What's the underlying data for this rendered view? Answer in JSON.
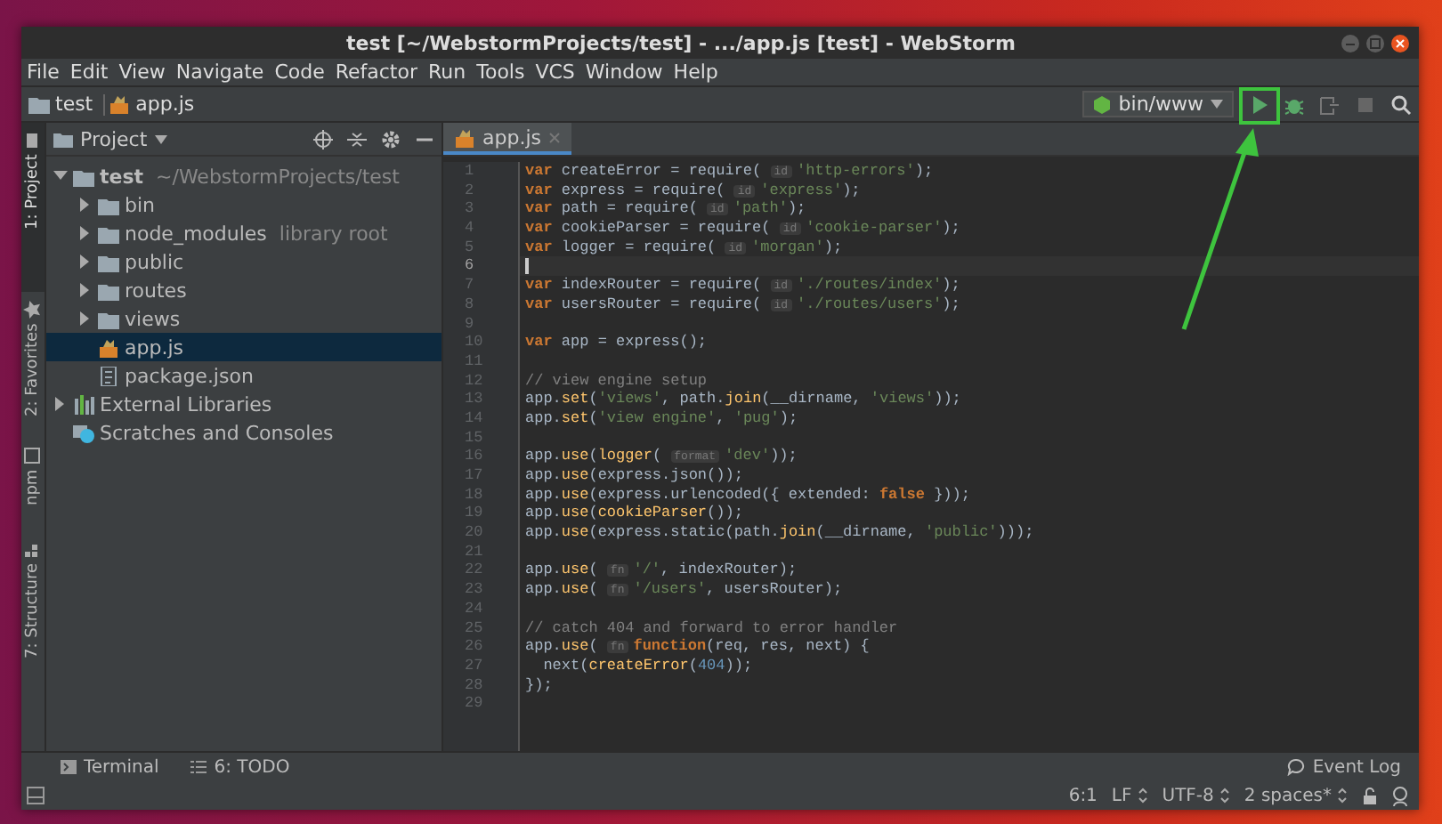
{
  "window": {
    "title": "test [~/WebstormProjects/test] - .../app.js [test] - WebStorm"
  },
  "menu": [
    "File",
    "Edit",
    "View",
    "Navigate",
    "Code",
    "Refactor",
    "Run",
    "Tools",
    "VCS",
    "Window",
    "Help"
  ],
  "breadcrumbs": [
    {
      "kind": "folder",
      "label": "test"
    },
    {
      "kind": "js",
      "label": "app.js"
    }
  ],
  "run_configuration": {
    "label": "bin/www"
  },
  "side_tabs": [
    {
      "label": "1: Project",
      "kind": "project",
      "selected": true
    },
    {
      "label": "2: Favorites",
      "kind": "star",
      "selected": false
    },
    {
      "label": "npm",
      "kind": "npm",
      "selected": false
    },
    {
      "label": "7: Structure",
      "kind": "structure",
      "selected": false
    }
  ],
  "project_panel": {
    "title": "Project",
    "items": [
      {
        "kind": "folder",
        "label": "test",
        "suffix": "~/WebstormProjects/test",
        "expanded": true,
        "selected": false,
        "children": [
          {
            "kind": "folder",
            "label": "bin",
            "expanded": false,
            "selected": false
          },
          {
            "kind": "folder",
            "label": "node_modules",
            "suffix": "library root",
            "expanded": false,
            "selected": false
          },
          {
            "kind": "folder",
            "label": "public",
            "expanded": false,
            "selected": false
          },
          {
            "kind": "folder",
            "label": "routes",
            "expanded": false,
            "selected": false
          },
          {
            "kind": "folder",
            "label": "views",
            "expanded": false,
            "selected": false
          },
          {
            "kind": "js",
            "label": "app.js",
            "selected": true
          },
          {
            "kind": "json",
            "label": "package.json",
            "selected": false
          }
        ]
      },
      {
        "kind": "library",
        "label": "External Libraries",
        "expanded": false,
        "selected": false
      },
      {
        "kind": "scratches",
        "label": "Scratches and Consoles",
        "selected": false
      }
    ]
  },
  "editor": {
    "tab": {
      "label": "app.js",
      "selected": true
    },
    "lines": [
      {
        "number": "1",
        "current": false,
        "tokens": [
          {
            "kind": "keyword",
            "text": "var"
          },
          {
            "kind": "plain",
            "text": " createError = require( "
          },
          {
            "kind": "hint",
            "text": "id"
          },
          {
            "kind": "string",
            "text": "'http-errors'"
          },
          {
            "kind": "plain",
            "text": ");"
          }
        ]
      },
      {
        "number": "2",
        "current": false,
        "tokens": [
          {
            "kind": "keyword",
            "text": "var"
          },
          {
            "kind": "plain",
            "text": " express = require( "
          },
          {
            "kind": "hint",
            "text": "id"
          },
          {
            "kind": "string",
            "text": "'express'"
          },
          {
            "kind": "plain",
            "text": ");"
          }
        ]
      },
      {
        "number": "3",
        "current": false,
        "tokens": [
          {
            "kind": "keyword",
            "text": "var"
          },
          {
            "kind": "plain",
            "text": " path = require( "
          },
          {
            "kind": "hint",
            "text": "id"
          },
          {
            "kind": "string",
            "text": "'path'"
          },
          {
            "kind": "plain",
            "text": ");"
          }
        ]
      },
      {
        "number": "4",
        "current": false,
        "tokens": [
          {
            "kind": "keyword",
            "text": "var"
          },
          {
            "kind": "plain",
            "text": " cookieParser = require( "
          },
          {
            "kind": "hint",
            "text": "id"
          },
          {
            "kind": "string",
            "text": "'cookie-parser'"
          },
          {
            "kind": "plain",
            "text": ");"
          }
        ]
      },
      {
        "number": "5",
        "current": false,
        "tokens": [
          {
            "kind": "keyword",
            "text": "var"
          },
          {
            "kind": "plain",
            "text": " logger = require( "
          },
          {
            "kind": "hint",
            "text": "id"
          },
          {
            "kind": "string",
            "text": "'morgan'"
          },
          {
            "kind": "plain",
            "text": ");"
          }
        ]
      },
      {
        "number": "6",
        "current": true
      },
      {
        "number": "7",
        "current": false,
        "tokens": [
          {
            "kind": "keyword",
            "text": "var"
          },
          {
            "kind": "plain",
            "text": " indexRouter = require( "
          },
          {
            "kind": "hint",
            "text": "id"
          },
          {
            "kind": "string",
            "text": "'./routes/index'"
          },
          {
            "kind": "plain",
            "text": ");"
          }
        ]
      },
      {
        "number": "8",
        "current": false,
        "tokens": [
          {
            "kind": "keyword",
            "text": "var"
          },
          {
            "kind": "plain",
            "text": " usersRouter = require( "
          },
          {
            "kind": "hint",
            "text": "id"
          },
          {
            "kind": "string",
            "text": "'./routes/users'"
          },
          {
            "kind": "plain",
            "text": ");"
          }
        ]
      },
      {
        "number": "9",
        "current": false
      },
      {
        "number": "10",
        "current": false,
        "tokens": [
          {
            "kind": "keyword",
            "text": "var"
          },
          {
            "kind": "plain",
            "text": " app = express();"
          }
        ]
      },
      {
        "number": "11",
        "current": false
      },
      {
        "number": "12",
        "current": false,
        "tokens": [
          {
            "kind": "comment",
            "text": "// view engine setup"
          }
        ]
      },
      {
        "number": "13",
        "current": false,
        "tokens": [
          {
            "kind": "plain",
            "text": "app."
          },
          {
            "kind": "call",
            "text": "set"
          },
          {
            "kind": "plain",
            "text": "("
          },
          {
            "kind": "string",
            "text": "'views'"
          },
          {
            "kind": "plain",
            "text": ", path."
          },
          {
            "kind": "call",
            "text": "join"
          },
          {
            "kind": "plain",
            "text": "(__dirname, "
          },
          {
            "kind": "string",
            "text": "'views'"
          },
          {
            "kind": "plain",
            "text": "));"
          }
        ]
      },
      {
        "number": "14",
        "current": false,
        "tokens": [
          {
            "kind": "plain",
            "text": "app."
          },
          {
            "kind": "call",
            "text": "set"
          },
          {
            "kind": "plain",
            "text": "("
          },
          {
            "kind": "string",
            "text": "'view engine'"
          },
          {
            "kind": "plain",
            "text": ", "
          },
          {
            "kind": "string",
            "text": "'pug'"
          },
          {
            "kind": "plain",
            "text": ");"
          }
        ]
      },
      {
        "number": "15",
        "current": false
      },
      {
        "number": "16",
        "current": false,
        "tokens": [
          {
            "kind": "plain",
            "text": "app."
          },
          {
            "kind": "call",
            "text": "use"
          },
          {
            "kind": "plain",
            "text": "("
          },
          {
            "kind": "call",
            "text": "logger"
          },
          {
            "kind": "plain",
            "text": "( "
          },
          {
            "kind": "hint",
            "text": "format"
          },
          {
            "kind": "string",
            "text": "'dev'"
          },
          {
            "kind": "plain",
            "text": "));"
          }
        ]
      },
      {
        "number": "17",
        "current": false,
        "tokens": [
          {
            "kind": "plain",
            "text": "app."
          },
          {
            "kind": "call",
            "text": "use"
          },
          {
            "kind": "plain",
            "text": "(express.json());"
          }
        ]
      },
      {
        "number": "18",
        "current": false,
        "tokens": [
          {
            "kind": "plain",
            "text": "app."
          },
          {
            "kind": "call",
            "text": "use"
          },
          {
            "kind": "plain",
            "text": "(express.urlencoded({ extended: "
          },
          {
            "kind": "keyword",
            "text": "false"
          },
          {
            "kind": "plain",
            "text": " }));"
          }
        ]
      },
      {
        "number": "19",
        "current": false,
        "tokens": [
          {
            "kind": "plain",
            "text": "app."
          },
          {
            "kind": "call",
            "text": "use"
          },
          {
            "kind": "plain",
            "text": "("
          },
          {
            "kind": "call",
            "text": "cookieParser"
          },
          {
            "kind": "plain",
            "text": "());"
          }
        ]
      },
      {
        "number": "20",
        "current": false,
        "tokens": [
          {
            "kind": "plain",
            "text": "app."
          },
          {
            "kind": "call",
            "text": "use"
          },
          {
            "kind": "plain",
            "text": "(express.static(path."
          },
          {
            "kind": "call",
            "text": "join"
          },
          {
            "kind": "plain",
            "text": "(__dirname, "
          },
          {
            "kind": "string",
            "text": "'public'"
          },
          {
            "kind": "plain",
            "text": ")));"
          }
        ]
      },
      {
        "number": "21",
        "current": false
      },
      {
        "number": "22",
        "current": false,
        "tokens": [
          {
            "kind": "plain",
            "text": "app."
          },
          {
            "kind": "call",
            "text": "use"
          },
          {
            "kind": "plain",
            "text": "( "
          },
          {
            "kind": "hint",
            "text": "fn"
          },
          {
            "kind": "string",
            "text": "'/'"
          },
          {
            "kind": "plain",
            "text": ", indexRouter);"
          }
        ]
      },
      {
        "number": "23",
        "current": false,
        "tokens": [
          {
            "kind": "plain",
            "text": "app."
          },
          {
            "kind": "call",
            "text": "use"
          },
          {
            "kind": "plain",
            "text": "( "
          },
          {
            "kind": "hint",
            "text": "fn"
          },
          {
            "kind": "string",
            "text": "'/users'"
          },
          {
            "kind": "plain",
            "text": ", usersRouter);"
          }
        ]
      },
      {
        "number": "24",
        "current": false
      },
      {
        "number": "25",
        "current": false,
        "tokens": [
          {
            "kind": "comment",
            "text": "// catch 404 and forward to error handler"
          }
        ]
      },
      {
        "number": "26",
        "current": false,
        "tokens": [
          {
            "kind": "plain",
            "text": "app."
          },
          {
            "kind": "call",
            "text": "use"
          },
          {
            "kind": "plain",
            "text": "( "
          },
          {
            "kind": "hint",
            "text": "fn"
          },
          {
            "kind": "keyword",
            "text": "function"
          },
          {
            "kind": "plain",
            "text": "(req, res, next) {"
          }
        ]
      },
      {
        "number": "27",
        "current": false,
        "tokens": [
          {
            "kind": "plain",
            "text": "  next("
          },
          {
            "kind": "call",
            "text": "createError"
          },
          {
            "kind": "plain",
            "text": "("
          },
          {
            "kind": "number",
            "text": "404"
          },
          {
            "kind": "plain",
            "text": "));"
          }
        ]
      },
      {
        "number": "28",
        "current": false,
        "tokens": [
          {
            "kind": "plain",
            "text": "});"
          }
        ]
      },
      {
        "number": "29",
        "current": false
      }
    ]
  },
  "bottom_tabs": [
    {
      "kind": "terminal",
      "label": "Terminal"
    },
    {
      "kind": "todo",
      "label": "6: TODO"
    }
  ],
  "event_log": {
    "label": "Event Log"
  },
  "status_bar": {
    "position": "6:1",
    "line_separator": "LF",
    "encoding": "UTF-8",
    "indent": "2 spaces*"
  }
}
